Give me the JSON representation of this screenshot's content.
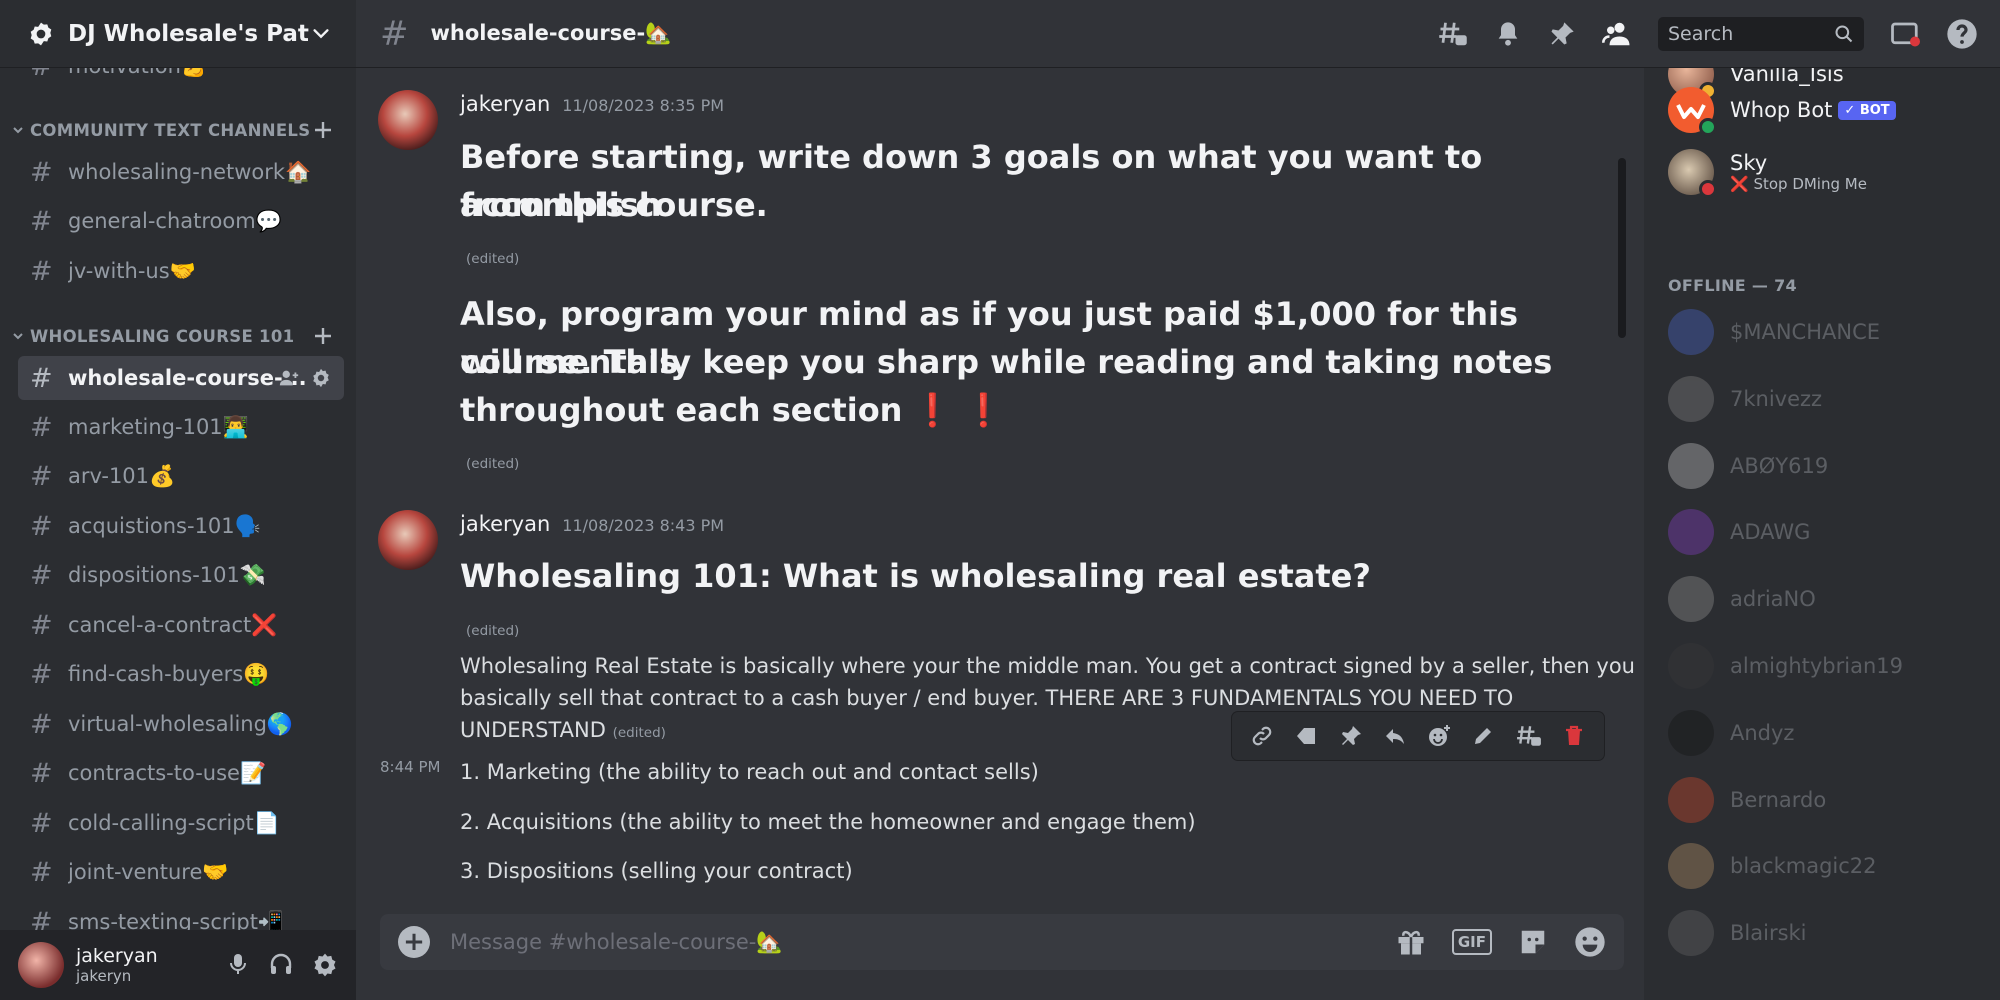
{
  "server": {
    "name": "DJ Wholesale's Path ..."
  },
  "channels": {
    "partial_top": "motivation💪",
    "categories": [
      {
        "label": "COMMUNITY TEXT CHANNELS",
        "items": [
          "wholesaling-network🏠",
          "general-chatroom💬",
          "jv-with-us🤝"
        ]
      },
      {
        "label": "WHOLESALING COURSE 101",
        "items": [
          "wholesale-course-...",
          "marketing-101👨‍💻",
          "arv-101💰",
          "acquistions-101🗣️",
          "dispositions-101💸",
          "cancel-a-contract❌",
          "find-cash-buyers🤑",
          "virtual-wholesaling🌎",
          "contracts-to-use📝",
          "cold-calling-script📄",
          "joint-venture🤝",
          "sms-texting-script📲"
        ]
      }
    ]
  },
  "user": {
    "display_name": "jakeryan",
    "username": "jakeryn"
  },
  "chat": {
    "channel_name": "wholesale-course-🏡",
    "search_placeholder": "Search",
    "composer_placeholder": "Message #wholesale-course-🏡",
    "messages": [
      {
        "author": "jakeryan",
        "time": "11/08/2023 8:35 PM",
        "line1": "Before starting, write down 3 goals on what you want to accomplish",
        "line2": "from this course.",
        "edited1": "(edited)",
        "p2_line1": "Also, program your mind as if you just paid $1,000 for this course. This",
        "p2_line2": "will mentally keep you sharp while reading and taking notes",
        "p2_line3": "throughout each section",
        "exclaim": "❗ ❗",
        "edited2": "(edited)"
      },
      {
        "author": "jakeryan",
        "time": "11/08/2023 8:43 PM",
        "title": "Wholesaling 101: What is wholesaling real estate?",
        "edited1": "(edited)",
        "body_l1": "Wholesaling Real Estate is basically where your the middle man. You get a contract signed by a seller, then you",
        "body_l2": "basically sell that contract to a cash buyer / end buyer. THERE ARE 3 FUNDAMENTALS YOU NEED TO",
        "body_l3": "UNDERSTAND",
        "edited_inline": "(edited)"
      },
      {
        "time": "8:44 PM",
        "items": [
          "1. Marketing (the ability to reach out and contact sells)",
          "2. Acquisitions (the ability to meet the homeowner and engage them)",
          "3. Dispositions (selling your contract)"
        ]
      }
    ]
  },
  "members": {
    "online": [
      {
        "name": "Vanilla_Isis"
      },
      {
        "name": "Whop Bot",
        "badge": "✓ BOT"
      },
      {
        "name": "Sky",
        "status": "❌ Stop DMing Me"
      }
    ],
    "offline_label": "OFFLINE — 74",
    "offline": [
      "$MANCHANCE",
      "7knivezz",
      "ABØY619",
      "ADAWG",
      "adriaNO",
      "almightybrian19",
      "Andyz",
      "Bernardo",
      "blackmagic22",
      "Blairski"
    ]
  },
  "colors": {
    "accent": "#5865f2",
    "danger": "#da373c",
    "online": "#23a55a",
    "bg_chat": "#313338",
    "bg_side": "#2b2d31"
  }
}
